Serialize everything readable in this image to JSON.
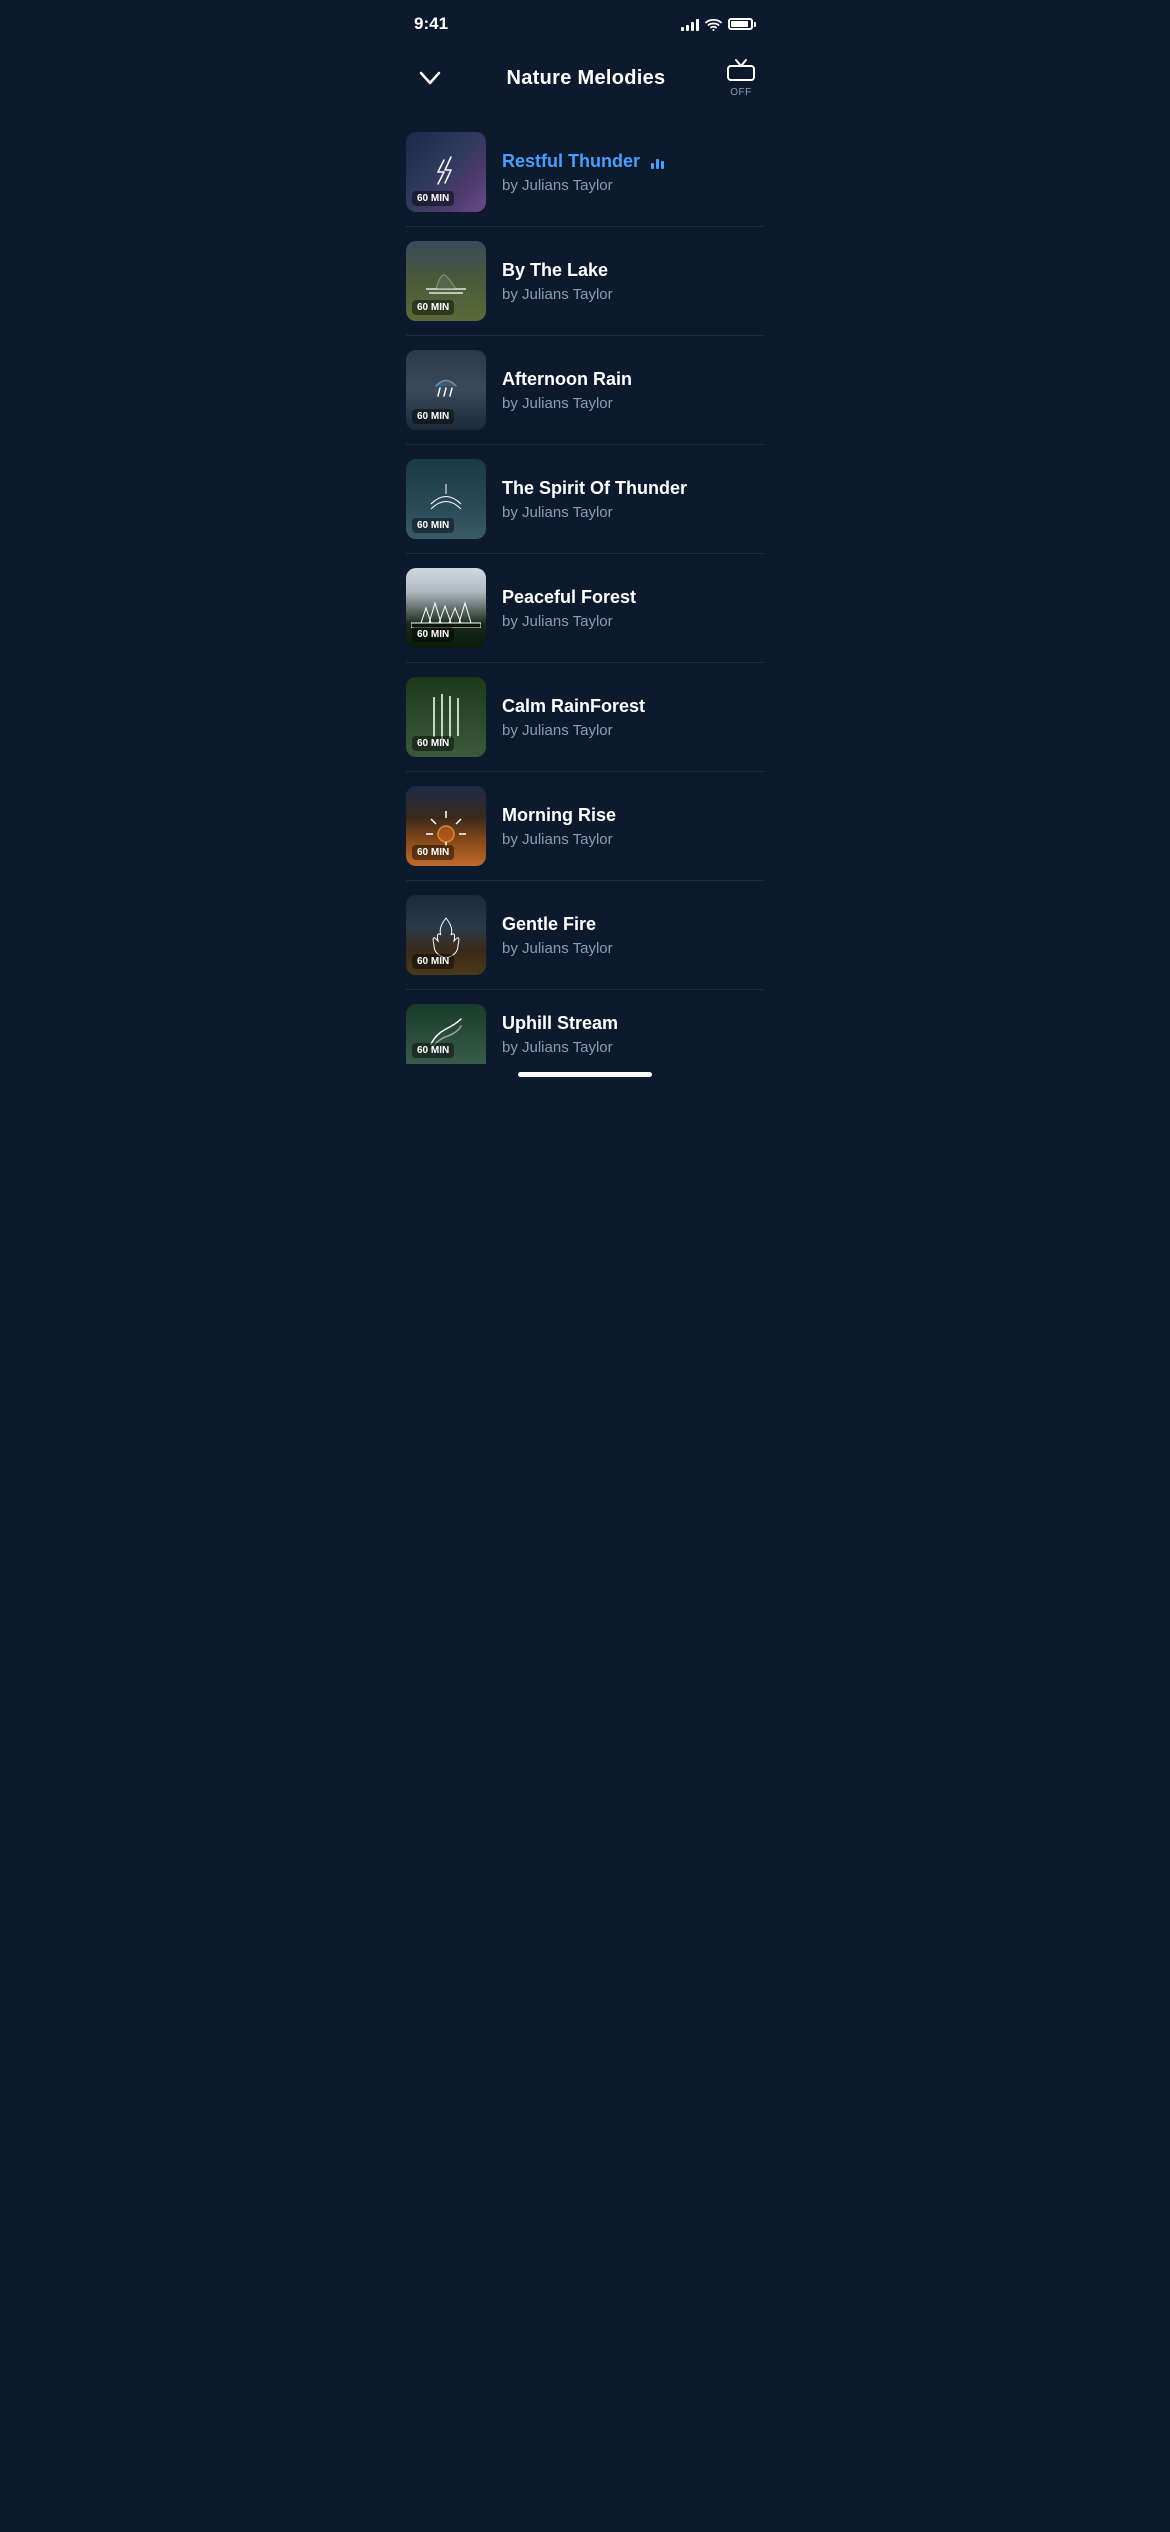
{
  "statusBar": {
    "time": "9:41",
    "offLabel": "OFF"
  },
  "header": {
    "title": "Nature Melodies",
    "chevronLabel": "chevron-down",
    "repeatLabel": "OFF"
  },
  "tracks": [
    {
      "id": 1,
      "name": "Restful Thunder",
      "author": "by Julians Taylor",
      "duration": "60 MIN",
      "thumb": "thunder",
      "active": true,
      "playing": true
    },
    {
      "id": 2,
      "name": "By The Lake",
      "author": "by Julians Taylor",
      "duration": "60 MIN",
      "thumb": "lake",
      "active": false,
      "playing": false
    },
    {
      "id": 3,
      "name": "Afternoon Rain",
      "author": "by Julians Taylor",
      "duration": "60 MIN",
      "thumb": "rain",
      "active": false,
      "playing": false
    },
    {
      "id": 4,
      "name": "The Spirit Of Thunder",
      "author": "by Julians Taylor",
      "duration": "60 MIN",
      "thumb": "spirit",
      "active": false,
      "playing": false
    },
    {
      "id": 5,
      "name": "Peaceful Forest",
      "author": "by Julians Taylor",
      "duration": "60 MIN",
      "thumb": "forest",
      "active": false,
      "playing": false
    },
    {
      "id": 6,
      "name": "Calm RainForest",
      "author": "by Julians Taylor",
      "duration": "60 MIN",
      "thumb": "rainforest",
      "active": false,
      "playing": false
    },
    {
      "id": 7,
      "name": "Morning Rise",
      "author": "by Julians Taylor",
      "duration": "60 MIN",
      "thumb": "morning",
      "active": false,
      "playing": false
    },
    {
      "id": 8,
      "name": "Gentle Fire",
      "author": "by Julians Taylor",
      "duration": "60 MIN",
      "thumb": "fire",
      "active": false,
      "playing": false
    },
    {
      "id": 9,
      "name": "Uphill Stream",
      "author": "by Julians Taylor",
      "duration": "60 MIN",
      "thumb": "uphill",
      "active": false,
      "playing": false
    }
  ]
}
